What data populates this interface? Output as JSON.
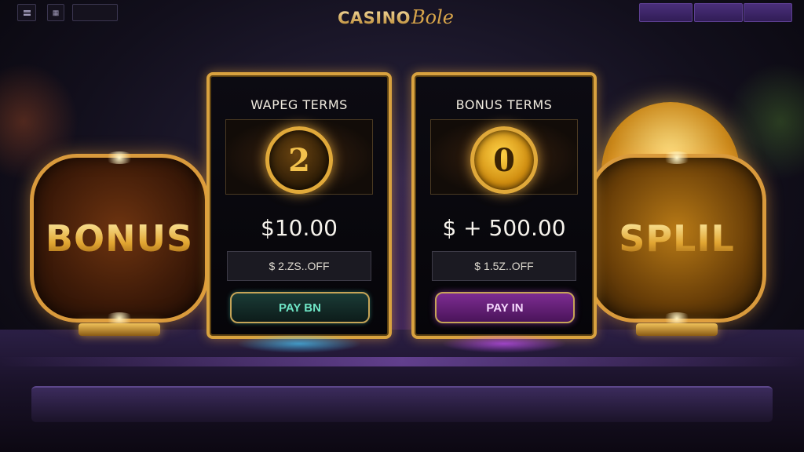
{
  "header": {
    "logo_main": "CASINO",
    "logo_script": "Bole",
    "left_button_label": "",
    "right_buttons": [
      "",
      "",
      ""
    ]
  },
  "badges": {
    "left": "BONUS",
    "right": "SPLIL"
  },
  "cards": [
    {
      "title": "WAPEG TERMS",
      "medal": "2",
      "amount": "$10.00",
      "off": "$ 2.ZS..OFF",
      "button": "PAY BN"
    },
    {
      "title": "BONUS TERMS",
      "medal": "0",
      "amount": "$ + 500.00",
      "off": "$ 1.5Z..OFF",
      "button": "PAY IN"
    }
  ],
  "colors": {
    "gold": "#d9a23f",
    "teal_button_text": "#6fe6c6",
    "purple_button": "#7d2c92"
  }
}
